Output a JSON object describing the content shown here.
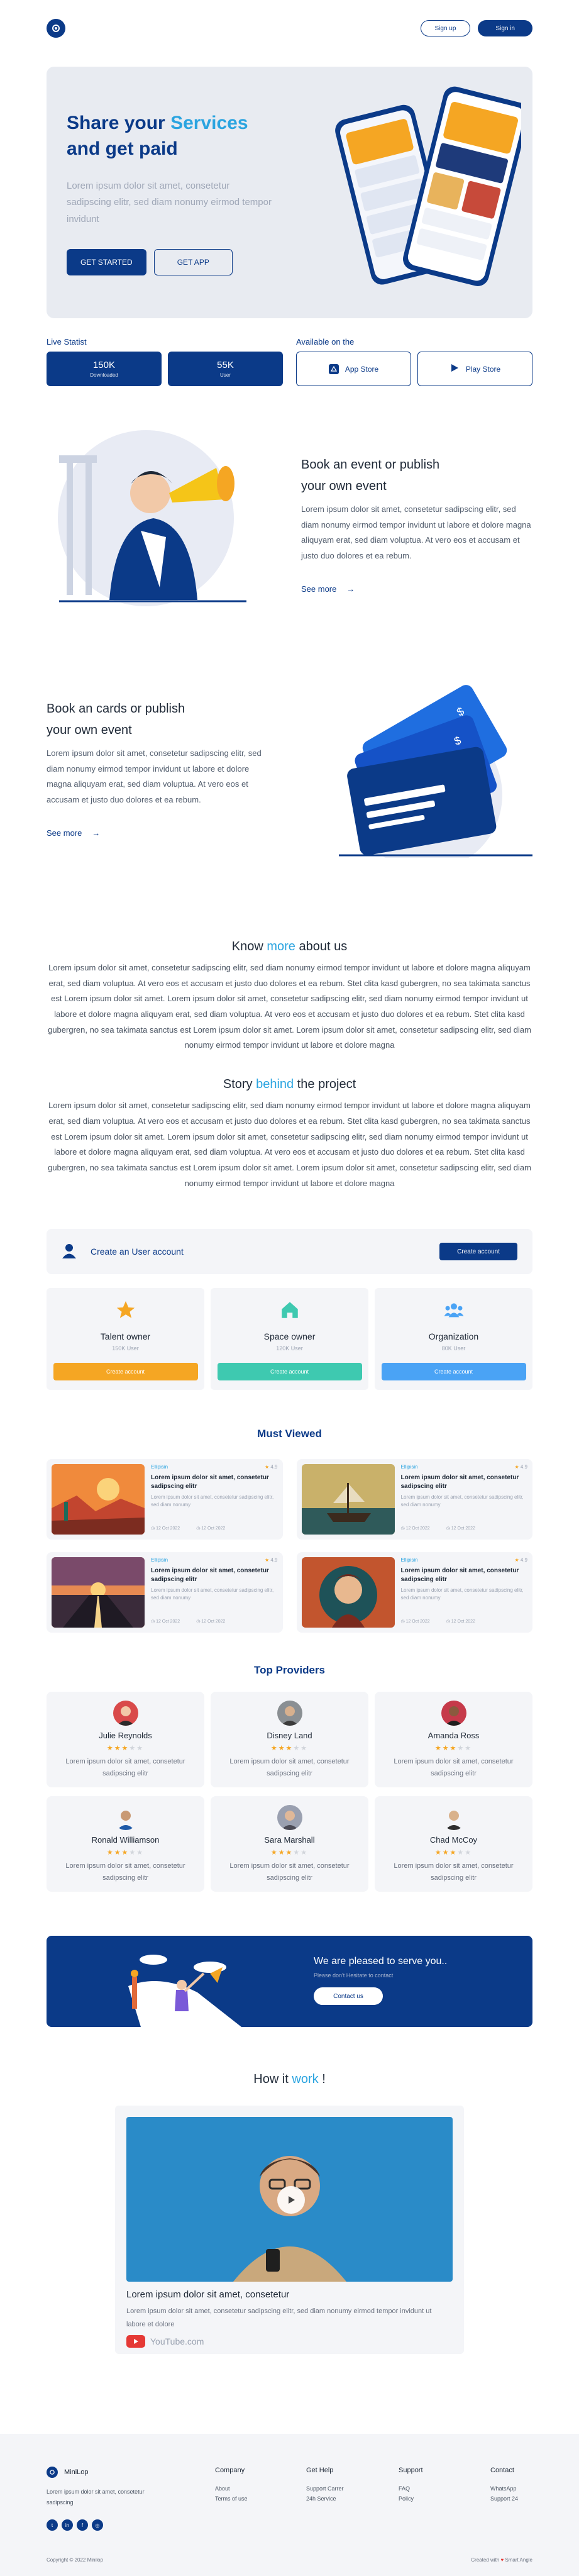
{
  "header": {
    "signup_label": "Sign up",
    "signin_label": "Sign in"
  },
  "hero": {
    "title_prefix": "Share your",
    "title_accent": "Services",
    "title_suffix": "and get paid",
    "description": "Lorem ipsum dolor sit amet, consetetur sadipscing elitr, sed diam nonumy eirmod tempor invidunt",
    "get_started_label": "GET STARTED",
    "get_app_label": "GET APP"
  },
  "stats": {
    "live_label": "Live Statist",
    "available_label": "Available on the",
    "items": [
      {
        "value": "150K",
        "label": "Downloaded"
      },
      {
        "value": "55K",
        "label": "User"
      }
    ],
    "stores": [
      {
        "label": "App Store",
        "icon": "apple-icon"
      },
      {
        "label": "Play Store",
        "icon": "play-icon"
      }
    ]
  },
  "feature_event": {
    "title_line1": "Book an event or publish",
    "title_line2": "your own event",
    "description": "Lorem ipsum dolor sit amet, consetetur sadipscing elitr, sed diam nonumy eirmod tempor invidunt ut labore et dolore magna aliquyam erat, sed diam voluptua. At vero eos et accusam et justo duo dolores et ea rebum.",
    "see_more": "See more"
  },
  "feature_cards": {
    "title_line1": "Book an cards or publish",
    "title_line2": "your own event",
    "description": "Lorem ipsum dolor sit amet, consetetur sadipscing elitr, sed diam nonumy eirmod tempor invidunt ut labore et dolore magna aliquyam erat, sed diam voluptua. At vero eos et accusam et justo duo dolores et ea rebum.",
    "see_more": "See more"
  },
  "about": {
    "heading_prefix": "Know",
    "heading_accent": "more",
    "heading_suffix": "about us",
    "paragraph": "Lorem ipsum dolor sit amet, consetetur sadipscing elitr, sed diam nonumy eirmod tempor invidunt ut labore et dolore magna aliquyam erat, sed diam voluptua. At vero eos et accusam et justo duo dolores et ea rebum. Stet clita kasd gubergren, no sea takimata sanctus est Lorem ipsum dolor sit amet. Lorem ipsum dolor sit amet, consetetur sadipscing elitr, sed diam nonumy eirmod tempor invidunt ut labore et dolore magna aliquyam erat, sed diam voluptua. At vero eos et accusam et justo duo dolores et ea rebum. Stet clita kasd gubergren, no sea takimata sanctus est Lorem ipsum dolor sit amet. Lorem ipsum dolor sit amet, consetetur sadipscing elitr, sed diam nonumy eirmod tempor invidunt ut labore et dolore magna"
  },
  "story": {
    "heading_prefix": "Story",
    "heading_accent": "behind",
    "heading_suffix": "the project",
    "paragraph": "Lorem ipsum dolor sit amet, consetetur sadipscing elitr, sed diam nonumy eirmod tempor invidunt ut labore et dolore magna aliquyam erat, sed diam voluptua. At vero eos et accusam et justo duo dolores et ea rebum. Stet clita kasd gubergren, no sea takimata sanctus est Lorem ipsum dolor sit amet. Lorem ipsum dolor sit amet, consetetur sadipscing elitr, sed diam nonumy eirmod tempor invidunt ut labore et dolore magna aliquyam erat, sed diam voluptua. At vero eos et accusam et justo duo dolores et ea rebum. Stet clita kasd gubergren, no sea takimata sanctus est Lorem ipsum dolor sit amet. Lorem ipsum dolor sit amet, consetetur sadipscing elitr, sed diam nonumy eirmod tempor invidunt ut labore et dolore magna"
  },
  "create_account": {
    "label": "Create an User account",
    "button": "Create account",
    "roles": [
      {
        "title": "Talent owner",
        "sub": "150K User",
        "button": "Create account",
        "color": "#f5a623",
        "icon": "star-icon"
      },
      {
        "title": "Space owner",
        "sub": "120K User",
        "button": "Create account",
        "color": "#3ec9b0",
        "icon": "home-icon"
      },
      {
        "title": "Organization",
        "sub": "80K User",
        "button": "Create account",
        "color": "#4aa3f5",
        "icon": "group-icon"
      }
    ]
  },
  "must_viewed": {
    "heading": "Must Viewed",
    "items": [
      {
        "source": "Ellipisin",
        "rating": "4.9",
        "title": "Lorem ipsum dolor sit amet, consetetur sadipscing elitr",
        "desc": "Lorem ipsum dolor sit amet, consetetur sadipscing elitr, sed diam nonumy",
        "date_start": "12 Oct 2022",
        "date_end": "12 Oct 2022"
      },
      {
        "source": "Ellipisin",
        "rating": "4.9",
        "title": "Lorem ipsum dolor sit amet, consetetur sadipscing elitr",
        "desc": "Lorem ipsum dolor sit amet, consetetur sadipscing elitr, sed diam nonumy",
        "date_start": "12 Oct 2022",
        "date_end": "12 Oct 2022"
      },
      {
        "source": "Ellipisin",
        "rating": "4.9",
        "title": "Lorem ipsum dolor sit amet, consetetur sadipscing elitr",
        "desc": "Lorem ipsum dolor sit amet, consetetur sadipscing elitr, sed diam nonumy",
        "date_start": "12 Oct 2022",
        "date_end": "12 Oct 2022"
      },
      {
        "source": "Ellipisin",
        "rating": "4.9",
        "title": "Lorem ipsum dolor sit amet, consetetur sadipscing elitr",
        "desc": "Lorem ipsum dolor sit amet, consetetur sadipscing elitr, sed diam nonumy",
        "date_start": "12 Oct 2022",
        "date_end": "12 Oct 2022"
      }
    ]
  },
  "providers": {
    "heading": "Top Providers",
    "items": [
      {
        "name": "Julie Reynolds",
        "rating": 3,
        "desc": "Lorem ipsum dolor sit amet, consetetur sadipscing elitr"
      },
      {
        "name": "Disney Land",
        "rating": 3,
        "desc": "Lorem ipsum dolor sit amet, consetetur sadipscing elitr"
      },
      {
        "name": "Amanda Ross",
        "rating": 3,
        "desc": "Lorem ipsum dolor sit amet, consetetur sadipscing elitr"
      },
      {
        "name": "Ronald Williamson",
        "rating": 3,
        "desc": "Lorem ipsum dolor sit amet, consetetur sadipscing elitr"
      },
      {
        "name": "Sara Marshall",
        "rating": 3,
        "desc": "Lorem ipsum dolor sit amet, consetetur sadipscing elitr"
      },
      {
        "name": "Chad McCoy",
        "rating": 3,
        "desc": "Lorem ipsum dolor sit amet, consetetur sadipscing elitr"
      }
    ]
  },
  "banner": {
    "title": "We are pleased to serve you..",
    "subtitle": "Please don't Hesitate to contact",
    "button": "Contact us"
  },
  "how_it_works": {
    "heading_prefix": "How it",
    "heading_accent": "work",
    "heading_suffix": "!",
    "video_title": "Lorem ipsum dolor sit amet, consetetur",
    "video_desc": "Lorem ipsum dolor sit amet, consetetur sadipscing elitr, sed diam nonumy eirmod tempor invidunt ut labore et dolore",
    "source": "YouTube.com"
  },
  "footer": {
    "brand": "MiniLop",
    "brand_desc": "Lorem ipsum dolor sit amet, consetetur sadipscing",
    "columns": [
      {
        "title": "Company",
        "links": [
          "About",
          "Terms of use"
        ]
      },
      {
        "title": "Get Help",
        "links": [
          "Support Carrer",
          "24h Service"
        ]
      },
      {
        "title": "Support",
        "links": [
          "FAQ",
          "Policy"
        ]
      },
      {
        "title": "Contact",
        "links": [
          "WhatsApp",
          "Support 24"
        ]
      }
    ],
    "copyright": "Copyright © 2022 Minilop",
    "created_with": "Created with",
    "author": "Smart Angle"
  },
  "colors": {
    "primary": "#0b3a88",
    "accent": "#2aa4e0",
    "star": "#f5a623"
  }
}
